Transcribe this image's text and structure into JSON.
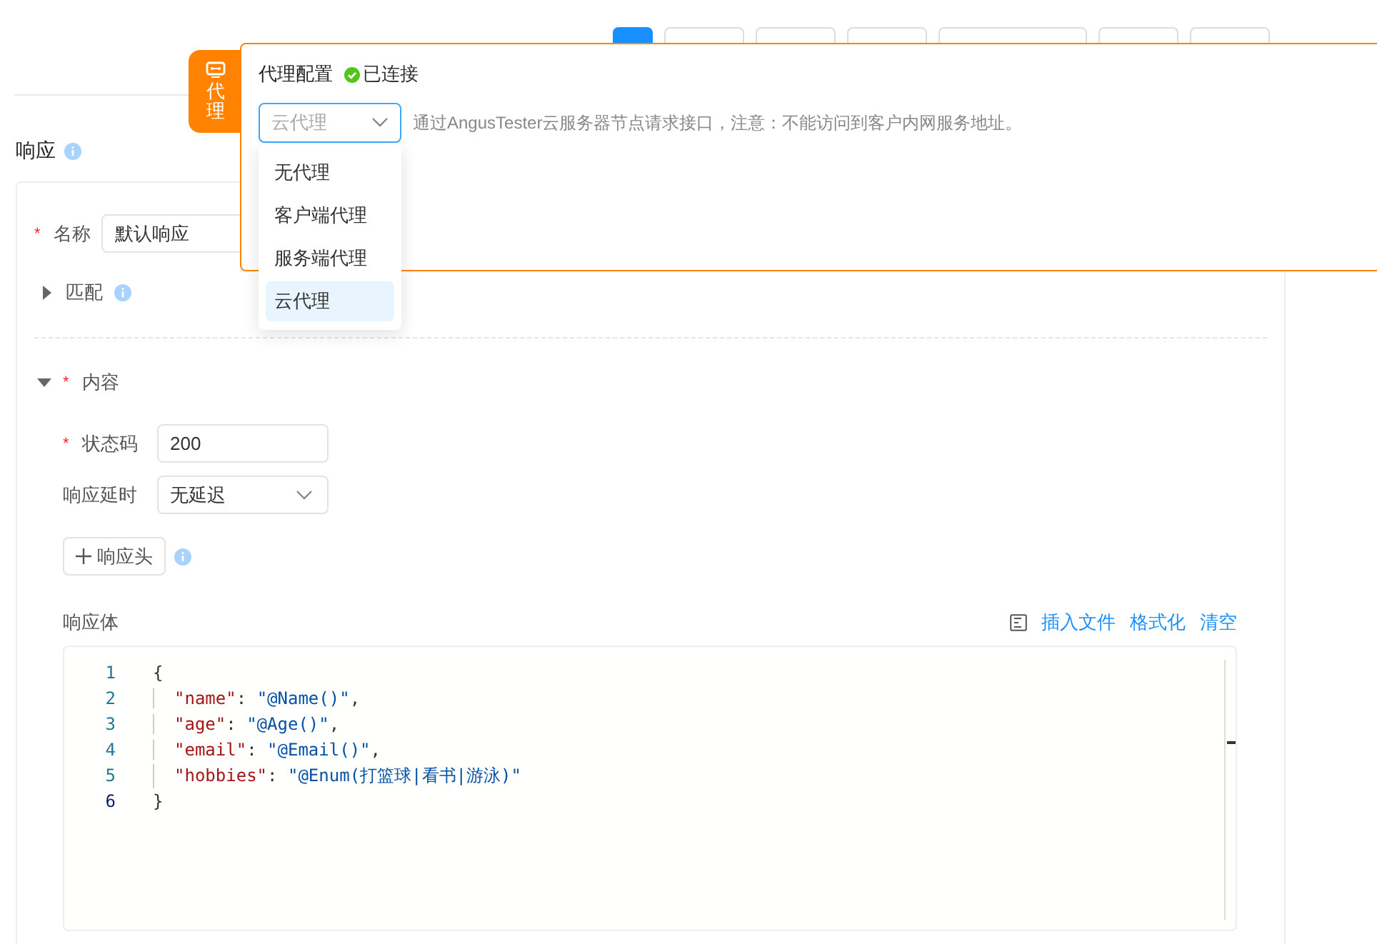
{
  "toolbar": {
    "buttons": [
      {
        "kind": "primary"
      },
      {
        "kind": "default"
      },
      {
        "kind": "default"
      },
      {
        "kind": "default"
      },
      {
        "kind": "default"
      },
      {
        "kind": "default"
      },
      {
        "kind": "default"
      }
    ]
  },
  "required_symbol": "*",
  "proxy": {
    "tab_label": "代理",
    "title": "代理配置",
    "status": "已连接",
    "connected": true,
    "select_value": "云代理",
    "hint": "通过AngusTester云服务器节点请求接口，注意：不能访问到客户内网服务地址。",
    "options": [
      {
        "label": "无代理",
        "selected": false
      },
      {
        "label": "客户端代理",
        "selected": false
      },
      {
        "label": "服务端代理",
        "selected": false
      },
      {
        "label": "云代理",
        "selected": true
      }
    ]
  },
  "response": {
    "title": "响应",
    "name": {
      "label": "名称",
      "required": true,
      "value": "默认响应"
    },
    "match": {
      "label": "匹配",
      "expanded": false
    },
    "content": {
      "label": "内容",
      "required": true,
      "expanded": true
    },
    "status_code": {
      "label": "状态码",
      "required": true,
      "value": "200"
    },
    "delay": {
      "label": "响应延时",
      "value": "无延迟"
    },
    "header_button": "响应头",
    "body": {
      "label": "响应体",
      "actions": [
        "插入文件",
        "格式化",
        "清空"
      ],
      "lines": [
        {
          "number": "1",
          "active": false,
          "tokens": [
            {
              "kind": "punct",
              "text": "{"
            }
          ]
        },
        {
          "number": "2",
          "active": false,
          "tokens": [
            {
              "kind": "key",
              "text": "\"name\""
            },
            {
              "kind": "punct",
              "text": ": "
            },
            {
              "kind": "string",
              "text": "\"@Name()\""
            },
            {
              "kind": "punct",
              "text": ","
            }
          ]
        },
        {
          "number": "3",
          "active": false,
          "tokens": [
            {
              "kind": "key",
              "text": "\"age\""
            },
            {
              "kind": "punct",
              "text": ": "
            },
            {
              "kind": "string",
              "text": "\"@Age()\""
            },
            {
              "kind": "punct",
              "text": ","
            }
          ]
        },
        {
          "number": "4",
          "active": false,
          "tokens": [
            {
              "kind": "key",
              "text": "\"email\""
            },
            {
              "kind": "punct",
              "text": ": "
            },
            {
              "kind": "string",
              "text": "\"@Email()\""
            },
            {
              "kind": "punct",
              "text": ","
            }
          ]
        },
        {
          "number": "5",
          "active": false,
          "tokens": [
            {
              "kind": "key",
              "text": "\"hobbies\""
            },
            {
              "kind": "punct",
              "text": ": "
            },
            {
              "kind": "string",
              "text": "\"@Enum(打篮球|看书|游泳)\""
            }
          ]
        },
        {
          "number": "6",
          "active": true,
          "tokens": [
            {
              "kind": "punct",
              "text": "}"
            }
          ]
        }
      ]
    }
  }
}
